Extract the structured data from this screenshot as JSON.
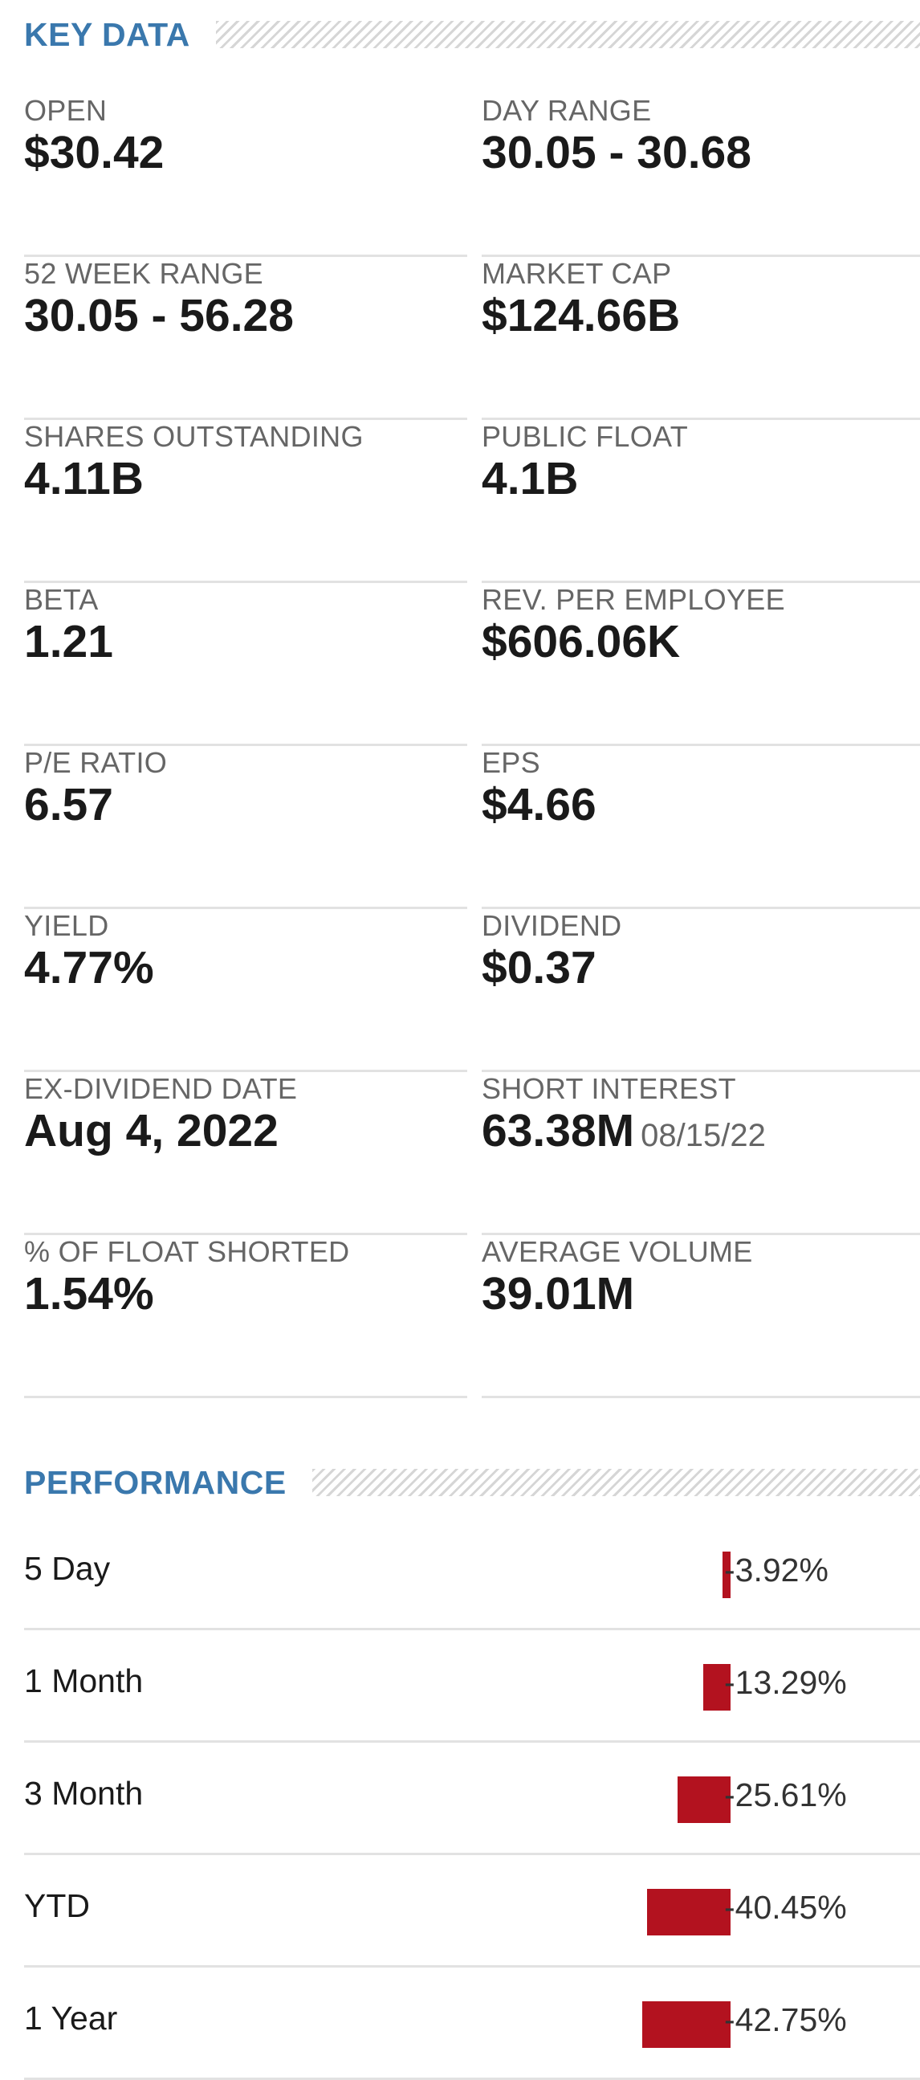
{
  "key_data": {
    "title": "KEY DATA",
    "items": [
      {
        "label": "OPEN",
        "value": "$30.42"
      },
      {
        "label": "DAY RANGE",
        "value": "30.05 - 30.68"
      },
      {
        "label": "52 WEEK RANGE",
        "value": "30.05 - 56.28"
      },
      {
        "label": "MARKET CAP",
        "value": "$124.66B"
      },
      {
        "label": "SHARES OUTSTANDING",
        "value": "4.11B"
      },
      {
        "label": "PUBLIC FLOAT",
        "value": "4.1B"
      },
      {
        "label": "BETA",
        "value": "1.21"
      },
      {
        "label": "REV. PER EMPLOYEE",
        "value": "$606.06K"
      },
      {
        "label": "P/E RATIO",
        "value": "6.57"
      },
      {
        "label": "EPS",
        "value": "$4.66"
      },
      {
        "label": "YIELD",
        "value": "4.77%"
      },
      {
        "label": "DIVIDEND",
        "value": "$0.37"
      },
      {
        "label": "EX-DIVIDEND DATE",
        "value": "Aug 4, 2022"
      },
      {
        "label": "SHORT INTEREST",
        "value": "63.38M",
        "date": "08/15/22"
      },
      {
        "label": "% OF FLOAT SHORTED",
        "value": "1.54%"
      },
      {
        "label": "AVERAGE VOLUME",
        "value": "39.01M"
      }
    ]
  },
  "performance": {
    "title": "PERFORMANCE",
    "bar_color": "#b3121f",
    "rows": [
      {
        "label": "5 Day",
        "value_text": "-3.92%",
        "value": -3.92
      },
      {
        "label": "1 Month",
        "value_text": "-13.29%",
        "value": -13.29
      },
      {
        "label": "3 Month",
        "value_text": "-25.61%",
        "value": -25.61
      },
      {
        "label": "YTD",
        "value_text": "-40.45%",
        "value": -40.45
      },
      {
        "label": "1 Year",
        "value_text": "-42.75%",
        "value": -42.75
      }
    ]
  }
}
